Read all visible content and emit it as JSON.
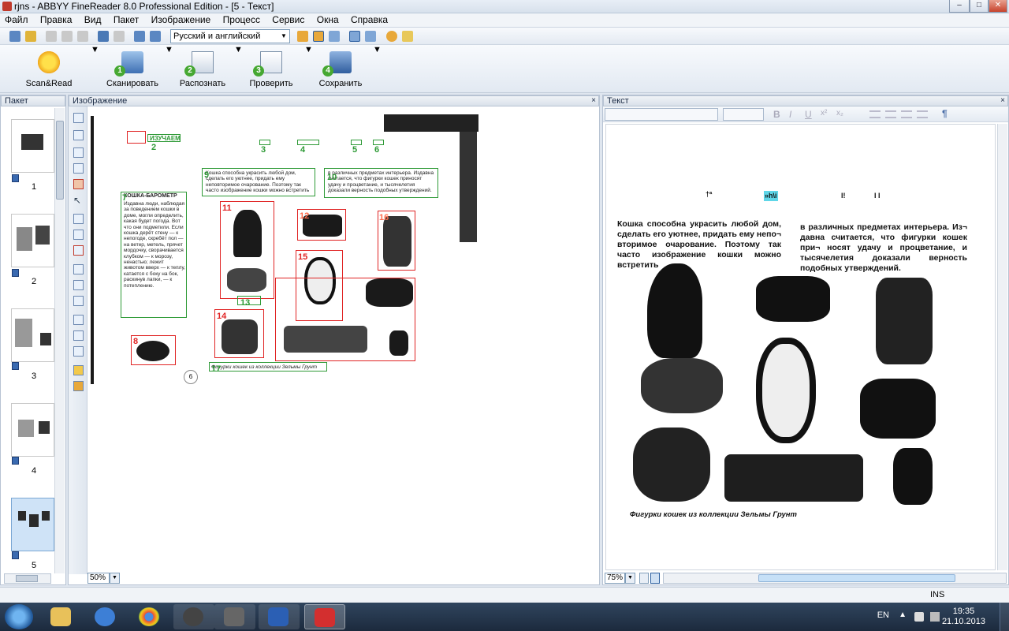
{
  "window": {
    "title": "rjns - ABBYY FineReader 8.0 Professional Edition - [5 - Текст]",
    "minimize": "–",
    "maximize": "□",
    "close": "✕"
  },
  "menu": [
    "Файл",
    "Правка",
    "Вид",
    "Пакет",
    "Изображение",
    "Процесс",
    "Сервис",
    "Окна",
    "Справка"
  ],
  "toolbar": {
    "language": "Русский и английский"
  },
  "bigtoolbar": {
    "scanread": "Scan&Read",
    "scan": "Сканировать",
    "recognize": "Распознать",
    "check": "Проверить",
    "save": "Сохранить",
    "step1": "1",
    "step2": "2",
    "step3": "3",
    "step4": "4"
  },
  "panes": {
    "batch": "Пакет",
    "image": "Изображение",
    "text": "Текст"
  },
  "thumbnails": [
    "1",
    "2",
    "3",
    "4",
    "5"
  ],
  "image": {
    "zoom": "50%",
    "blocks": [
      "2",
      "3",
      "4",
      "5",
      "6",
      "7",
      "8",
      "9",
      "10",
      "11",
      "12",
      "13",
      "14",
      "15",
      "16",
      "17"
    ],
    "heading_word": "ИЗУЧАЕМ",
    "sidebar_title": "КОШКА-БАРОМЕТР",
    "sidebar_text": "Издавна люди, наблюдая за поведением кошки в доме, могли определить, какая будет погода. Вот что они подметили. Если кошка дерёт стену — к непогоде, скребёт пол — на ветер, метель, прячет мордочку, сворачивается клубком — к морозу, ненастью; лежит животом вверх — к теплу, катается с боку на бок, раскинув лапки, — к потеплению.",
    "block9_text": "Кошка способна украсить любой дом, сделать его уютнее, придать ему неповторимое очарование. Поэтому так часто изображение кошки можно встретить",
    "block10_text": "в различных предметах интерьера. Издавна считается, что фигурки кошек приносят удачу и процветание, и тысячелетия доказали верность подобных утверждений.",
    "caption": "Фигурки кошек из коллекции Зельмы Грунт",
    "page_number": "6"
  },
  "text": {
    "zoom": "75%",
    "garbled1": "†ª",
    "garbled2": "»h\\i",
    "garbled3": "I!",
    "garbled4": "I I",
    "col1": "Кошка способна украсить любой дом, сделать его уютнее, придать ему непо¬ вторимое очарование. Поэтому так часто изображение кошки можно встретить",
    "col2": "в различных предметах интерьера. Из¬ давна считается, что фигурки кошек при¬ носят удачу и процветание, и тысячелетия доказали верность подобных утверждений.",
    "caption": "Фигурки кошек из коллекции Зельмы Грунт",
    "fmt": {
      "bold": "B",
      "italic": "I",
      "underline": "U",
      "superscript": "x²",
      "subscript": "x₂",
      "pilcrow": "¶"
    }
  },
  "status": {
    "mode": "INS"
  },
  "taskbar": {
    "lang": "EN",
    "time": "19:35",
    "date": "21.10.2013"
  }
}
